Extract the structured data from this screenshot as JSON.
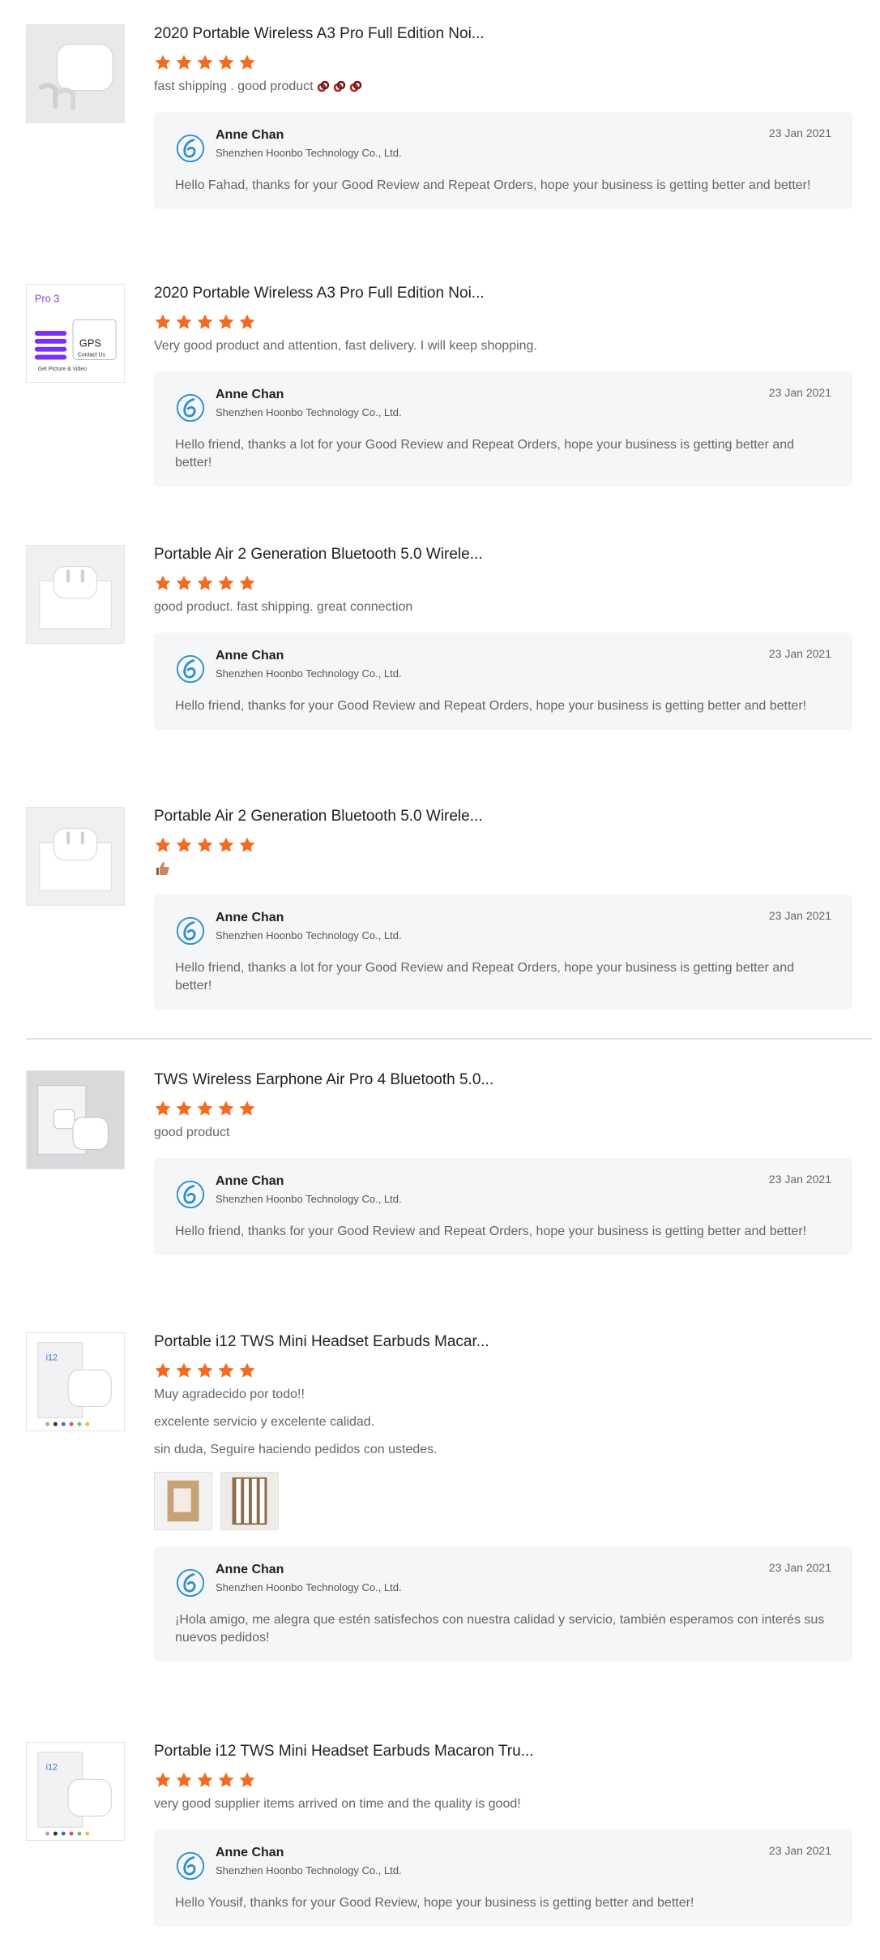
{
  "reviews": [
    {
      "title": "2020 Portable Wireless A3 Pro Full Edition Noi...",
      "rating": 5,
      "comment": [
        "fast shipping . good product"
      ],
      "emoji": [
        "chain-emoji",
        "chain-emoji",
        "chain-emoji"
      ],
      "thumbnail_icon": "earbuds-case-product-icon",
      "reply": {
        "name": "Anne Chan",
        "company": "Shenzhen Hoonbo Technology Co., Ltd.",
        "date": "23 Jan 2021",
        "text": "Hello Fahad, thanks for your Good Review and Repeat Orders, hope your business is getting better and better!"
      }
    },
    {
      "title": "2020 Portable Wireless A3 Pro Full Edition Noi...",
      "rating": 5,
      "comment": [
        "Very good product and attention, fast delivery. I will keep shopping."
      ],
      "thumbnail_icon": "gps-product-image",
      "thumbnail_text": {
        "heading": "Pro 3",
        "badge": "GPS",
        "sub": "Contact Us",
        "caption": "Get Picture & Video"
      },
      "reply": {
        "name": "Anne Chan",
        "company": "Shenzhen Hoonbo Technology Co., Ltd.",
        "date": "23 Jan 2021",
        "text": "Hello friend, thanks a lot for your Good Review and Repeat Orders, hope your business is getting better and better!"
      }
    },
    {
      "title": "Portable Air 2 Generation Bluetooth 5.0 Wirele...",
      "rating": 5,
      "comment": [
        "good product. fast shipping. great connection"
      ],
      "thumbnail_icon": "earbuds-box-product-icon",
      "reply": {
        "name": "Anne Chan",
        "company": "Shenzhen Hoonbo Technology Co., Ltd.",
        "date": "23 Jan 2021",
        "text": "Hello friend,  thanks for your Good Review and Repeat Orders, hope your business is getting better and better!"
      }
    },
    {
      "title": "Portable Air 2 Generation Bluetooth 5.0 Wirele...",
      "rating": 5,
      "comment": [],
      "thumbs_up": true,
      "thumbnail_icon": "earbuds-box-product-icon",
      "reply": {
        "name": "Anne Chan",
        "company": "Shenzhen Hoonbo Technology Co., Ltd.",
        "date": "23 Jan 2021",
        "text": "Hello friend, thanks a lot for your Good Review and Repeat Orders, hope your business is getting better and better!"
      }
    },
    {
      "title": "TWS Wireless Earphone Air Pro 4 Bluetooth 5.0...",
      "rating": 5,
      "comment": [
        "good product"
      ],
      "thumbnail_icon": "earphone-box-photo-icon",
      "reply": {
        "name": "Anne Chan",
        "company": "Shenzhen Hoonbo Technology Co., Ltd.",
        "date": "23 Jan 2021",
        "text": "Hello friend,  thanks for your Good Review and Repeat Orders, hope your business is getting better and better!"
      }
    },
    {
      "title": "Portable i12 TWS Mini Headset Earbuds Macar...",
      "rating": 5,
      "comment": [
        "Muy agradecido por todo!!",
        "excelente servicio y excelente calidad.",
        "sin duda, Seguire haciendo pedidos con ustedes."
      ],
      "photos": [
        "review-photo-package",
        "review-photo-boxes"
      ],
      "thumbnail_icon": "i12-box-product-icon",
      "thumbnail_text": {
        "label": "i12"
      },
      "reply": {
        "name": "Anne Chan",
        "company": "Shenzhen Hoonbo Technology Co., Ltd.",
        "date": "23 Jan 2021",
        "text": "¡Hola amigo, me alegra que estén satisfechos con nuestra calidad y servicio, también esperamos con interés sus nuevos pedidos!"
      }
    },
    {
      "title": "Portable i12 TWS Mini Headset Earbuds Macaron Tru...",
      "rating": 5,
      "comment": [
        "very good supplier items arrived on time and the quality is good!"
      ],
      "thumbnail_icon": "i12-box-product-icon",
      "thumbnail_text": {
        "label": "i12"
      },
      "reply": {
        "name": "Anne Chan",
        "company": "Shenzhen Hoonbo Technology Co., Ltd.",
        "date": "23 Jan 2021",
        "text": "Hello Yousif, thanks for your Good Review, hope your business is getting better and better!"
      }
    }
  ],
  "colors": {
    "star": "#f36b21",
    "reply_bg": "#f5f6f8",
    "logo": "#2f8fca"
  }
}
